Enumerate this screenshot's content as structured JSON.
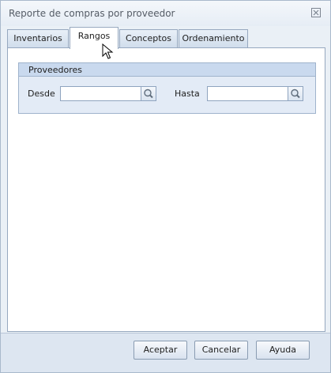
{
  "window": {
    "title": "Reporte de compras por proveedor",
    "close_glyph": "☒"
  },
  "tabs": [
    {
      "label": "Inventarios",
      "active": false
    },
    {
      "label": "Rangos",
      "active": true
    },
    {
      "label": "Conceptos",
      "active": false
    },
    {
      "label": "Ordenamiento",
      "active": false
    }
  ],
  "proveedores": {
    "group_title": "Proveedores",
    "desde_label": "Desde",
    "desde_value": "",
    "hasta_label": "Hasta",
    "hasta_value": ""
  },
  "footer": {
    "aceptar": "Aceptar",
    "cancelar": "Cancelar",
    "ayuda": "Ayuda"
  },
  "icons": {
    "search": "magnifier-icon",
    "cursor": "mouse-pointer-icon"
  }
}
